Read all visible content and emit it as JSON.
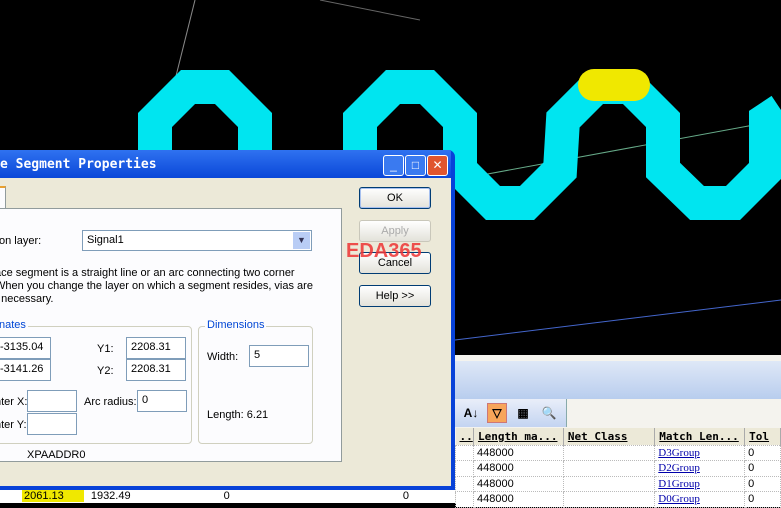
{
  "colors": {
    "trace": "#00e5f0",
    "highlight": "#f0e800",
    "board": "#000000"
  },
  "dialog": {
    "title": "e Segment Properties",
    "on_layer_label": "on layer:",
    "layer_value": "Signal1",
    "description": [
      "ace segment is a straight line or an arc connecting two corner",
      "When you change the layer on which a segment resides, vias are",
      "f necessary."
    ],
    "coords_group": "nates",
    "x1": "-3135.04",
    "x2": "-3141.26",
    "y1_label": "Y1:",
    "y1": "2208.31",
    "y2_label": "Y2:",
    "y2": "2208.31",
    "center_x_label": "nter X:",
    "center_y_label": "nter Y:",
    "center_x": "",
    "center_y": "",
    "arc_radius_label": "Arc radius:",
    "arc_radius": "0",
    "dimensions_group": "Dimensions",
    "width_label": "Width:",
    "width": "5",
    "length_label": "Length:",
    "length": "6.21",
    "net_name": "XPAADDR0",
    "ok": "OK",
    "apply": "Apply",
    "cancel": "Cancel",
    "help": "Help >>"
  },
  "watermark": "EDA365",
  "table": {
    "headers": [
      "..",
      "Length ma...",
      "Net Class",
      "Match Len...",
      "Tol"
    ],
    "rows": [
      [
        "448000",
        "",
        "D3Group",
        "0"
      ],
      [
        "448000",
        "",
        "D2Group",
        "0"
      ],
      [
        "448000",
        "",
        "D1Group",
        "0"
      ],
      [
        "448000",
        "",
        "D0Group",
        "0"
      ]
    ]
  },
  "behind_row": [
    "2061.13",
    "1932.49",
    "0",
    "0"
  ]
}
